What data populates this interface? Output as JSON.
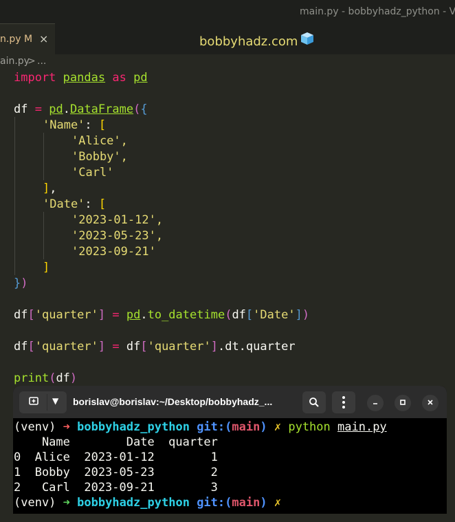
{
  "window": {
    "title": "main.py - bobbyhadz_python - Vi"
  },
  "tabs": [
    {
      "label": ".n.py",
      "modified": "M",
      "close": "×"
    }
  ],
  "tab_label_clip": "n.py",
  "brand": {
    "text": "bobbyhadz.com",
    "icon": "ice-cube-icon"
  },
  "breadcrumb": {
    "file": "ain.py",
    "separator": ">",
    "rest": "..."
  },
  "code": {
    "line1": {
      "kw1": "import",
      "mod": "pandas",
      "kw2": "as",
      "alias": "pd"
    },
    "line3": {
      "var": "df",
      "eq": "=",
      "obj": "pd",
      "dot": ".",
      "cls": "DataFrame",
      "open": "(",
      "brace": "{"
    },
    "line4": {
      "key": "'Name'",
      "colon": ":",
      "open": "["
    },
    "names": [
      "'Alice',",
      "'Bobby',",
      "'Carl'"
    ],
    "line8": {
      "close": "]",
      "comma": ","
    },
    "line9": {
      "key": "'Date'",
      "colon": ":",
      "open": "["
    },
    "dates": [
      "'2023-01-12',",
      "'2023-05-23',",
      "'2023-09-21'"
    ],
    "line13": {
      "close": "]"
    },
    "line14": {
      "brace": "}",
      "paren": ")"
    },
    "line16": {
      "df": "df",
      "lb": "[",
      "key": "'quarter'",
      "rb": "]",
      "eq": "=",
      "obj": "pd",
      "fn": "to_datetime",
      "arg": "df",
      "argkey": "'Date'"
    },
    "line18": {
      "df": "df",
      "lb": "[",
      "key": "'quarter'",
      "rb": "]",
      "eq": "=",
      "rhs_df": "df",
      "rhs_key": "'quarter'",
      "tail": ".dt.quarter"
    },
    "line20": {
      "fn": "print",
      "arg": "df"
    }
  },
  "terminal": {
    "title": "borislav@borislav:~/Desktop/bobbyhadz_...",
    "new_tab_icon": "new-tab-icon",
    "prompt": {
      "venv": "(venv)",
      "arrow": "➜",
      "dir": "bobbyhadz_python",
      "git": "git:",
      "branch_open": "(",
      "branch": "main",
      "branch_close": ")",
      "dirty": "✗"
    },
    "command": "python",
    "command_arg": "main.py",
    "output": [
      "    Name        Date  quarter",
      "0  Alice  2023-01-12        1",
      "1  Bobby  2023-05-23        2",
      "2   Carl  2023-09-21        3"
    ]
  }
}
